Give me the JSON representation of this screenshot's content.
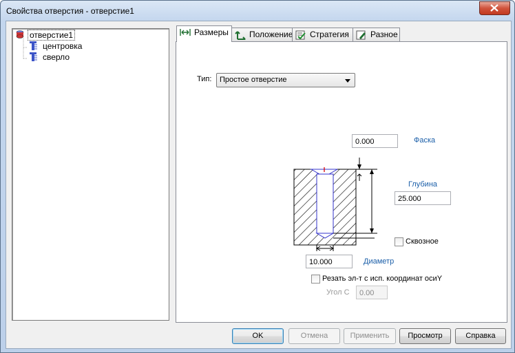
{
  "window": {
    "title": "Свойства отверстия - отверстие1"
  },
  "tree": {
    "root": "отверстие1",
    "children": [
      "центровка",
      "сверло"
    ]
  },
  "tabs": [
    {
      "label": "Размеры",
      "icon": "dimension-arrows-icon",
      "active": true
    },
    {
      "label": "Положение",
      "icon": "position-axes-icon"
    },
    {
      "label": "Стратегия",
      "icon": "strategy-check-icon"
    },
    {
      "label": "Разное",
      "icon": "misc-pencil-icon"
    }
  ],
  "form": {
    "type_label": "Тип:",
    "type_value": "Простое отверстие",
    "chamfer_value": "0.000",
    "chamfer_label": "Фаска",
    "depth_label": "Глубина",
    "depth_value": "25.000",
    "through_label": "Сквозное",
    "diameter_value": "10.000",
    "diameter_label": "Диаметр",
    "cut_label": "Резать эл-т с исп. координат осиY",
    "angle_label": "Угол C",
    "angle_value": "0.00"
  },
  "buttons": {
    "ok": "OK",
    "cancel": "Отмена",
    "apply": "Применить",
    "preview": "Просмотр",
    "help": "Справка"
  },
  "colors": {
    "link": "#1a5ea8",
    "hole_outline": "#3333cc"
  }
}
